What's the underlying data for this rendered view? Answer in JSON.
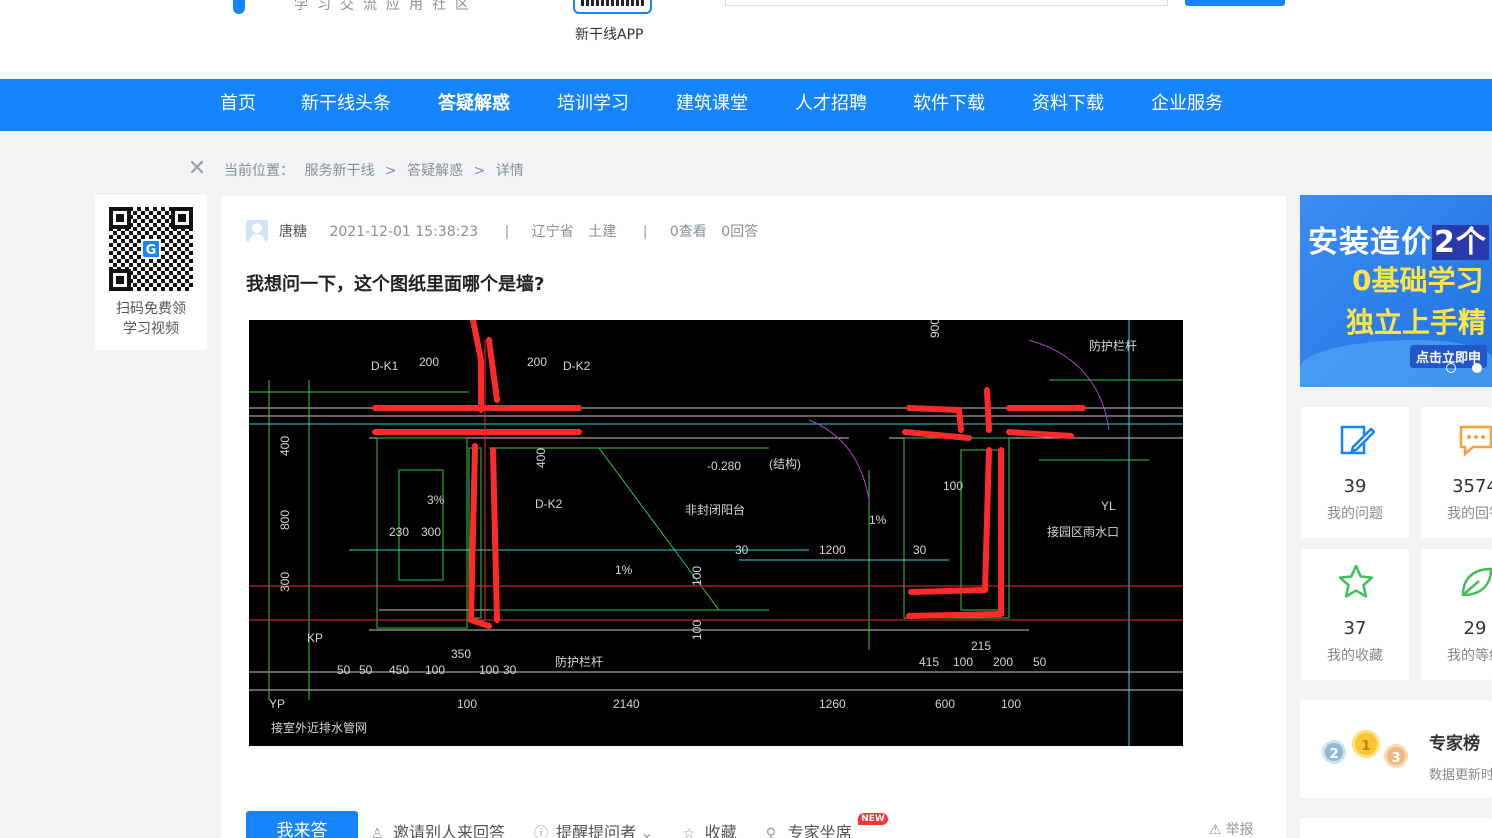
{
  "header": {
    "slogan": "学习交流应用社区",
    "app_label": "新干线APP"
  },
  "nav": {
    "items": [
      "首页",
      "新干线头条",
      "答疑解惑",
      "培训学习",
      "建筑课堂",
      "人才招聘",
      "软件下载",
      "资料下载",
      "企业服务"
    ],
    "active": "答疑解惑"
  },
  "breadcrumb": {
    "prefix": "当前位置：",
    "items": [
      "服务新干线",
      "答疑解惑",
      "详情"
    ],
    "separator": ">"
  },
  "qr_card": {
    "line1": "扫码免费领",
    "line2": "学习视频",
    "logo_letter": "G"
  },
  "question": {
    "user": "唐糖",
    "time": "2021-12-01 15:38:23",
    "region": "辽宁省",
    "category": "土建",
    "views": "0查看",
    "answers": "0回答",
    "title": "我想问一下，这个图纸里面哪个是墙?",
    "drawing_labels": [
      "D-K1",
      "200",
      "200",
      "D-K2",
      "防护栏杆",
      "-0.280",
      "(结构)",
      "非封闭阳台",
      "YL",
      "接园区雨水口",
      "3%",
      "230",
      "300",
      "D-K2",
      "1%",
      "30",
      "1200",
      "30",
      "100",
      "1%",
      "KP",
      "50",
      "50",
      "450",
      "100",
      "350",
      "100",
      "30",
      "防护栏杆",
      "415",
      "100",
      "200",
      "50",
      "215",
      "YP",
      "接室外近排水管网",
      "100",
      "2140",
      "1260",
      "600",
      "100",
      "400",
      "800",
      "300",
      "900",
      "100",
      "400",
      "100"
    ]
  },
  "actions": {
    "answer_button": "我来答",
    "invite": "邀请别人来回答",
    "remind": "提醒提问者",
    "favorite": "收藏",
    "expert": "专家坐席",
    "new_badge": "NEW",
    "report": "举报"
  },
  "banner": {
    "line1_a": "安装造价",
    "line1_b": "2个",
    "line2": "0基础学习",
    "line3": "独立上手精",
    "cta": "点击立即申"
  },
  "stats": [
    {
      "value": "39",
      "label": "我的问题",
      "icon": "edit-icon"
    },
    {
      "value": "3574",
      "label": "我的回答",
      "icon": "comment-icon"
    },
    {
      "value": "37",
      "label": "我的收藏",
      "icon": "star-icon"
    },
    {
      "value": "29",
      "label": "我的等级",
      "icon": "leaf-icon"
    }
  ],
  "expert_board": {
    "title": "专家榜",
    "subtitle": "数据更新时间"
  },
  "colors": {
    "brand": "#1684fc",
    "cad_bg": "#000000",
    "annotation_red": "#ff2a2a",
    "stat_blue": "#1684fc",
    "stat_orange": "#f7a13a",
    "stat_green": "#3fbf5a"
  }
}
